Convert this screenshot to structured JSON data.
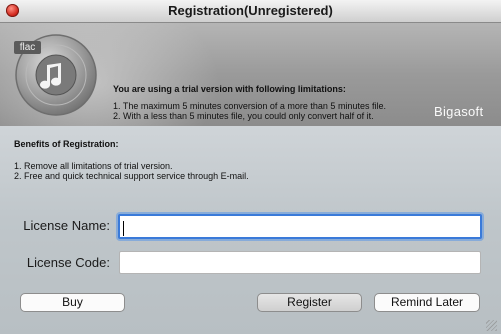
{
  "window": {
    "title": "Registration(Unregistered)"
  },
  "banner": {
    "badge": "flac",
    "trial_heading": "You are using a trial version with following limitations:",
    "limitations": [
      "1. The maximum 5 minutes conversion of a more than 5 minutes file.",
      "2. With a less than 5 minutes file, you could only convert half of it."
    ],
    "brand": "Bigasoft"
  },
  "benefits": {
    "heading": "Benefits of Registration:",
    "items": [
      "1. Remove all limitations of trial version.",
      "2. Free and quick technical support service through E-mail."
    ]
  },
  "form": {
    "license_name_label": "License Name:",
    "license_name_value": "",
    "license_code_label": "License Code:",
    "license_code_value": ""
  },
  "buttons": {
    "buy": "Buy",
    "register": "Register",
    "remind_later": "Remind Later"
  }
}
